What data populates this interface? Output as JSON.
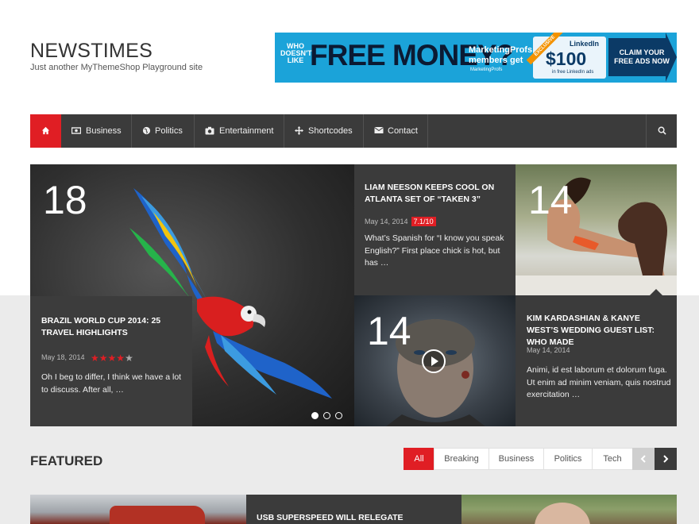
{
  "site": {
    "title": "NEWSTIMES",
    "tagline": "Just another MyThemeShop Playground site"
  },
  "ad": {
    "who": "WHO DOESN'T LIKE",
    "headline": "FREE MONEY?",
    "brand_line1": "MarketingProfs",
    "brand_line2": "members get",
    "brand_small": "MarketingProfs",
    "exclusive": "EXCLUSIVE",
    "linkedin": "LinkedIn",
    "amount": "$100",
    "in_ads": "in free LinkedIn ads",
    "cta": "CLAIM YOUR FREE ADS NOW"
  },
  "nav": {
    "items": [
      {
        "label": "Business",
        "icon": "money-icon"
      },
      {
        "label": "Politics",
        "icon": "globe-icon"
      },
      {
        "label": "Entertainment",
        "icon": "camera-icon"
      },
      {
        "label": "Shortcodes",
        "icon": "move-icon"
      },
      {
        "label": "Contact",
        "icon": "envelope-icon"
      }
    ]
  },
  "slider": {
    "number": "18",
    "title": "BRAZIL WORLD CUP 2014: 25 TRAVEL HIGHLIGHTS",
    "date": "May 18, 2014",
    "rating_stars": 4,
    "rating_max": 5,
    "excerpt": "Oh I beg to differ, I think we have a lot to discuss. After all, …"
  },
  "tiles": {
    "liam": {
      "title": "LIAM NEESON KEEPS COOL ON ATLANTA SET OF “TAKEN 3”",
      "date": "May 14, 2014",
      "score": "7.1/10",
      "excerpt": "What’s Spanish for “I know you speak English?” First place chick is hot, but has …"
    },
    "kim_image_number": "14",
    "movie_number": "14",
    "kim": {
      "title": "KIM KARDASHIAN & KANYE WEST’S WEDDING GUEST LIST: WHO MADE",
      "date": "May 14, 2014",
      "excerpt": "Animi, id est laborum et dolorum fuga. Ut enim ad minim veniam, quis nostrud exercitation …"
    }
  },
  "featured": {
    "title": "FEATURED",
    "tabs": [
      "All",
      "Breaking",
      "Business",
      "Politics",
      "Tech"
    ],
    "bottom_title": "USB SUPERSPEED WILL RELEGATE"
  },
  "colors": {
    "accent": "#e01e24",
    "nav_bg": "#3b3b3b",
    "card_bg": "#3c3c3c"
  }
}
